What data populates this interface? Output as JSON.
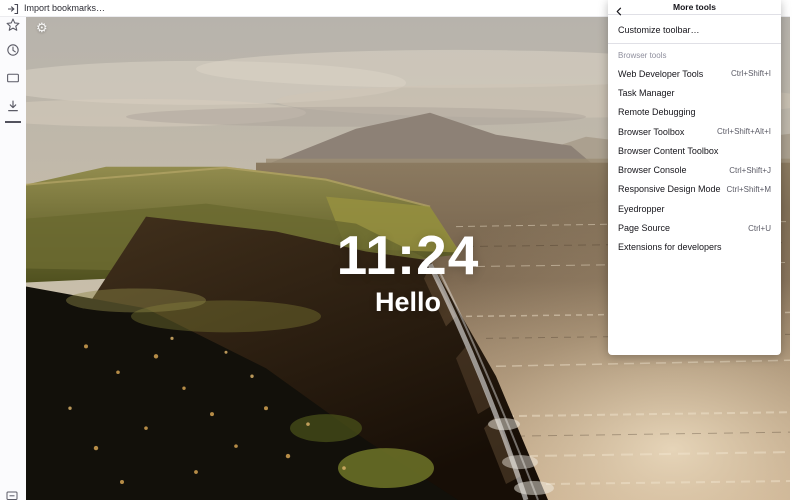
{
  "topbar": {
    "import_bookmarks_label": "Import bookmarks…"
  },
  "sidebar": {
    "icons": [
      {
        "name": "bookmarks-star-icon"
      },
      {
        "name": "history-clock-icon"
      },
      {
        "name": "synced-tabs-window-icon"
      },
      {
        "name": "downloads-icon"
      }
    ],
    "bottom_icon": {
      "name": "device-icon"
    }
  },
  "newtab": {
    "gear_glyph": "⚙",
    "clock_time": "11:24",
    "greeting": "Hello"
  },
  "menu": {
    "title": "More tools",
    "back_icon": "chevron-left-icon",
    "customize_label": "Customize toolbar…",
    "section_label": "Browser tools",
    "items": [
      {
        "label": "Web Developer Tools",
        "shortcut": "Ctrl+Shift+I"
      },
      {
        "label": "Task Manager",
        "shortcut": ""
      },
      {
        "label": "Remote Debugging",
        "shortcut": ""
      },
      {
        "label": "Browser Toolbox",
        "shortcut": "Ctrl+Shift+Alt+I"
      },
      {
        "label": "Browser Content Toolbox",
        "shortcut": ""
      },
      {
        "label": "Browser Console",
        "shortcut": "Ctrl+Shift+J"
      },
      {
        "label": "Responsive Design Mode",
        "shortcut": "Ctrl+Shift+M"
      },
      {
        "label": "Eyedropper",
        "shortcut": ""
      },
      {
        "label": "Page Source",
        "shortcut": "Ctrl+U"
      },
      {
        "label": "Extensions for developers",
        "shortcut": ""
      }
    ]
  },
  "theme": {
    "panel_bg": "#ffffff",
    "menu_text": "#15141a",
    "shortcut_text": "#5b5b66",
    "section_text": "#8f8f9d",
    "separator": "#e0e0e6",
    "sidebar_bg": "#fbfbfd",
    "clock_text": "#ffffff"
  }
}
